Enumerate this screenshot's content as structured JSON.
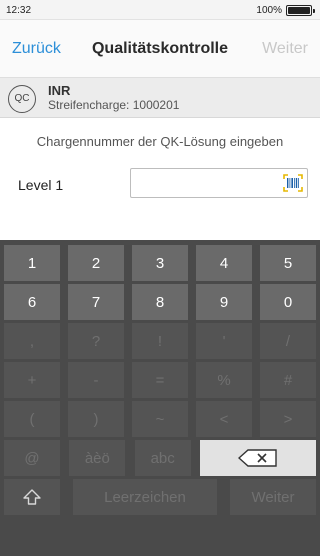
{
  "status": {
    "time": "12:32",
    "battery": "100%",
    "battery_level": 1.0
  },
  "nav": {
    "back_label": "Zurück",
    "title": "Qualitätskontrolle",
    "next_label": "Weiter"
  },
  "test": {
    "badge": "QC",
    "name": "INR",
    "lot": "Streifencharge: 1000201"
  },
  "instruction": "Chargennummer der QK-Lösung eingeben",
  "field": {
    "label": "Level 1",
    "value": "",
    "scan_icon": "barcode-icon"
  },
  "keyboard": {
    "row1": [
      "1",
      "2",
      "3",
      "4",
      "5"
    ],
    "row2": [
      "6",
      "7",
      "8",
      "9",
      "0"
    ],
    "row3": [
      ",",
      "?",
      "!",
      "'",
      "/"
    ],
    "row4": [
      "+",
      "-",
      "=",
      "%",
      "#"
    ],
    "row5": [
      "(",
      ")",
      "~",
      "<",
      ">"
    ],
    "row6": [
      "@",
      "àèö",
      "abc"
    ],
    "space_label": "Leerzeichen",
    "weiter_label": "Weiter",
    "backspace_icon": "backspace-icon",
    "shift_icon": "shift-icon"
  }
}
